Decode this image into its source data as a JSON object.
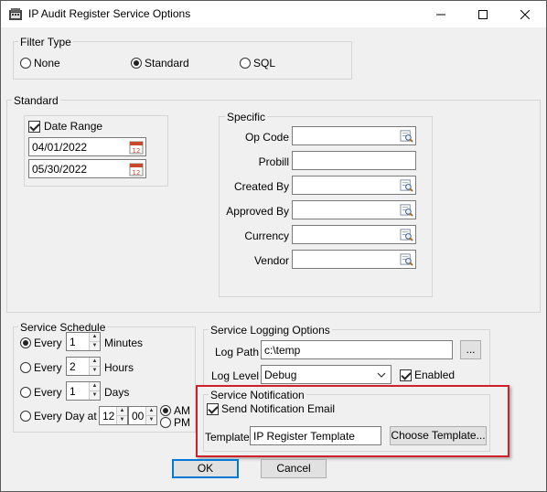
{
  "window": {
    "title": "IP Audit Register Service Options"
  },
  "filter_type": {
    "label": "Filter Type",
    "options": [
      {
        "label": "None",
        "checked": false
      },
      {
        "label": "Standard",
        "checked": true
      },
      {
        "label": "SQL",
        "checked": false
      }
    ]
  },
  "standard": {
    "label": "Standard",
    "date_range": {
      "label": "Date Range",
      "checked": true,
      "from": "04/01/2022",
      "to": "05/30/2022"
    },
    "specific": {
      "label": "Specific",
      "fields": [
        {
          "label": "Op Code",
          "value": "",
          "lookup": true
        },
        {
          "label": "Probill",
          "value": "",
          "lookup": false
        },
        {
          "label": "Created By",
          "value": "",
          "lookup": true
        },
        {
          "label": "Approved By",
          "value": "",
          "lookup": true
        },
        {
          "label": "Currency",
          "value": "",
          "lookup": true
        },
        {
          "label": "Vendor",
          "value": "",
          "lookup": true
        }
      ]
    }
  },
  "schedule": {
    "label": "Service Schedule",
    "every_label": "Every",
    "rows": [
      {
        "value": "1",
        "unit": "Minutes",
        "checked": true
      },
      {
        "value": "2",
        "unit": "Hours",
        "checked": false
      },
      {
        "value": "1",
        "unit": "Days",
        "checked": false
      }
    ],
    "every_day": {
      "label": "Every Day at",
      "hour": "12",
      "minute": "00",
      "am": "AM",
      "pm": "PM",
      "am_checked": true
    }
  },
  "logging": {
    "label": "Service Logging Options",
    "log_path_label": "Log Path",
    "log_path": "c:\\temp",
    "browse_label": "...",
    "log_level_label": "Log Level",
    "log_level": "Debug",
    "enabled_label": "Enabled",
    "enabled": true
  },
  "notification": {
    "label": "Service Notification",
    "send_label": "Send Notification Email",
    "send_checked": true,
    "template_label": "Template",
    "template_value": "IP Register Template",
    "choose_label": "Choose Template..."
  },
  "buttons": {
    "ok": "OK",
    "cancel": "Cancel"
  },
  "colors": {
    "highlight": "#d0202a",
    "focus": "#0078d7"
  }
}
